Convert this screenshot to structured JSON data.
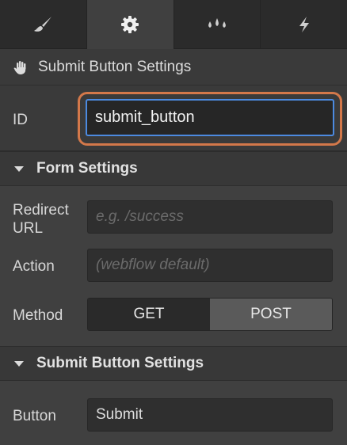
{
  "tabs": [
    {
      "icon": "paintbrush-icon",
      "active": false
    },
    {
      "icon": "gear-icon",
      "active": true
    },
    {
      "icon": "drops-icon",
      "active": false
    },
    {
      "icon": "lightning-icon",
      "active": false
    }
  ],
  "element": {
    "title": "Submit Button Settings",
    "icon": "hand-icon"
  },
  "id_field": {
    "label": "ID",
    "value": "submit_button"
  },
  "form_settings": {
    "title": "Form Settings",
    "redirect_label": "Redirect URL",
    "redirect_placeholder": "e.g. /success",
    "action_label": "Action",
    "action_placeholder": "(webflow default)",
    "method_label": "Method",
    "method_options": [
      "GET",
      "POST"
    ],
    "method_selected": "POST"
  },
  "submit_settings": {
    "title": "Submit Button Settings",
    "button_label": "Button",
    "button_value": "Submit"
  },
  "colors": {
    "focus_ring": "#d3784a",
    "input_focus_border": "#4c8ae0",
    "panel_bg": "#404040"
  }
}
